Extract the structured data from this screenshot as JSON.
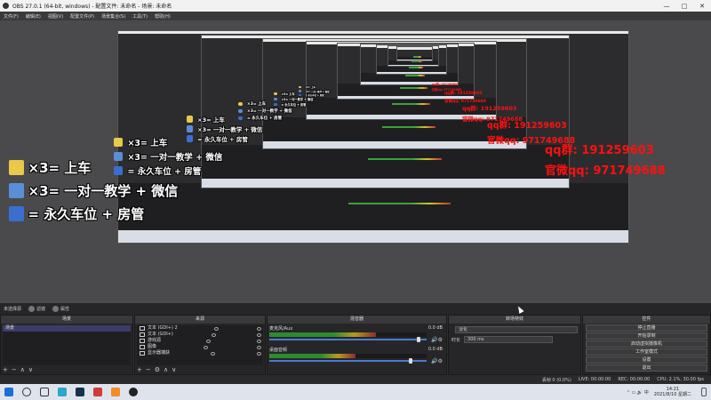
{
  "titlebar": {
    "title": "OBS 27.0.1 (64-bit, windows) - 配置文件: 未命名 - 场景: 未命名",
    "minimize": "—",
    "maximize": "□",
    "close": "✕"
  },
  "menu": [
    "文件(F)",
    "编辑(E)",
    "视图(V)",
    "配置文件(P)",
    "场景集合(S)",
    "工具(T)",
    "帮助(H)"
  ],
  "overlay": {
    "rows": [
      {
        "text": "×3= 上车",
        "icon": "pencil-icon",
        "color": "#e8c94a"
      },
      {
        "text": "×3= 一对一教学 + 微信",
        "icon": "ship-icon",
        "color": "#5a8fd8"
      },
      {
        "text": "= 永久车位 + 房管",
        "icon": "rocket-icon",
        "color": "#3a6fd0"
      }
    ],
    "qq_fan": "qq群: 191259603",
    "qq_official": "官微qq: 971749688"
  },
  "scenebar": {
    "label": "未选择源",
    "filter_button": "滤镜",
    "properties_button": "属性"
  },
  "scenes": {
    "header": "场景",
    "items": [
      "场景"
    ]
  },
  "sources": {
    "header": "来源",
    "items": [
      "文本 (GDI+) 2",
      "文本 (GDI+)",
      "游戏源",
      "图像",
      "显示器捕获"
    ]
  },
  "mixer": {
    "header": "混音器",
    "channels": [
      {
        "name": "麦克风/Aux",
        "db": "0.0 dB",
        "level": 0.68,
        "volume": 0.95
      },
      {
        "name": "桌面音频",
        "db": "0.0 dB",
        "level": 0.55,
        "volume": 0.9
      }
    ]
  },
  "transitions": {
    "header": "转场特效",
    "selected": "淡化",
    "duration_label": "时长",
    "duration_value": "300 ms"
  },
  "controls": {
    "header": "控件",
    "buttons": [
      "停止直播",
      "开始录制",
      "启动虚拟摄像机",
      "工作室模式",
      "设置",
      "退出"
    ]
  },
  "status": {
    "drop": "丢帧 0 (0.0%)",
    "live": "LIVE: 00:00:00",
    "rec": "REC: 00:00:00",
    "cpu": "CPU: 2.1%, 30.00 fps"
  },
  "taskbar": {
    "time": "14:21",
    "date": "2021/8/10 星期二"
  },
  "footer": {
    "add": "+",
    "remove": "−",
    "up": "∧",
    "down": "∨",
    "gear": "⚙"
  }
}
